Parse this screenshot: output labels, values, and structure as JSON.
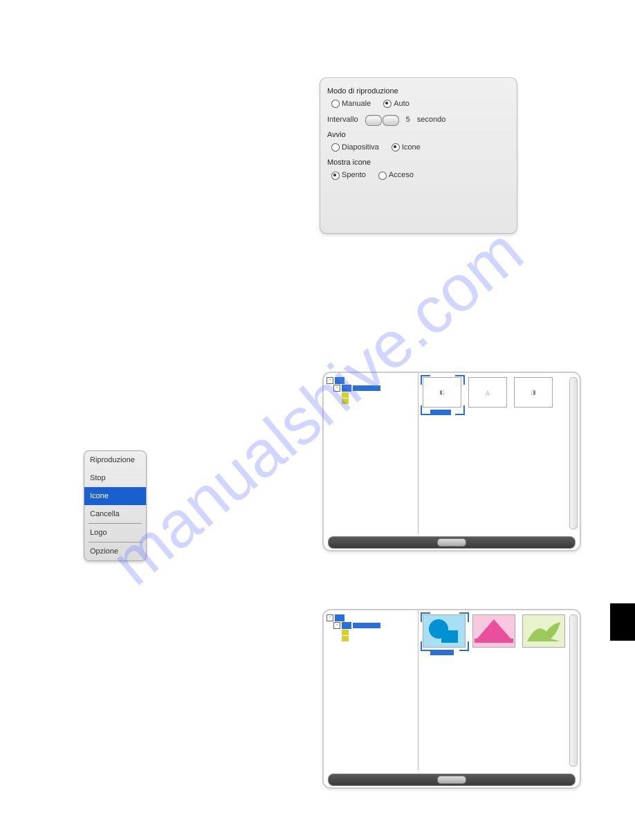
{
  "watermark": "manualshive.com",
  "settings_panel": {
    "playback_mode_title": "Modo di riproduzione",
    "manual": "Manuale",
    "auto": "Auto",
    "interval_label": "Intervallo",
    "interval_value": "5",
    "interval_unit": "secondo",
    "start_title": "Avvio",
    "slide": "Diapositiva",
    "icons": "Icone",
    "show_icons_title": "Mostra icone",
    "off": "Spento",
    "on": "Acceso"
  },
  "menu": {
    "play": "Riproduzione",
    "stop": "Stop",
    "icons": "Icone",
    "delete": "Cancella",
    "logo": "Logo",
    "option": "Opzione"
  }
}
